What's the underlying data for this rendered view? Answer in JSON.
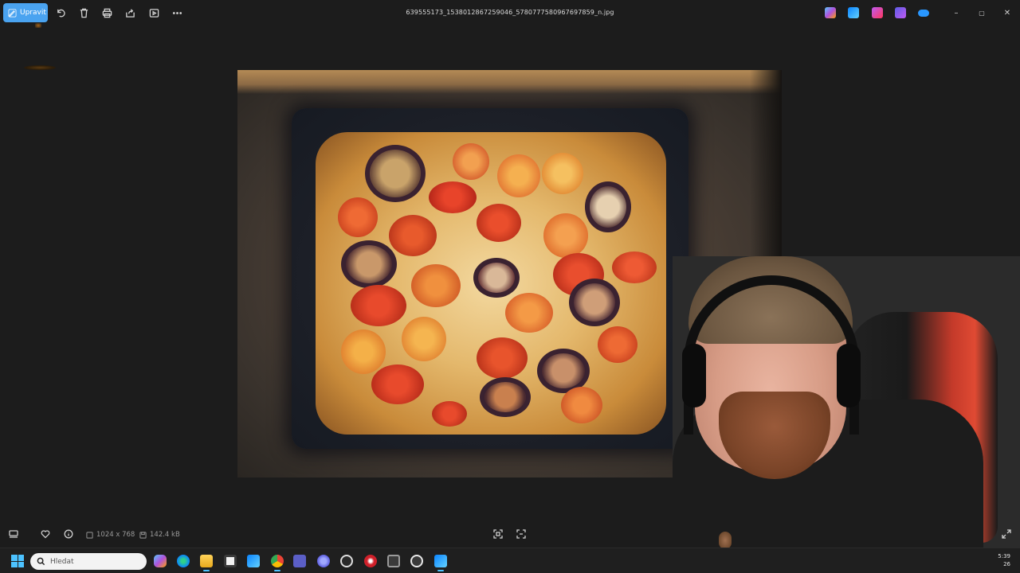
{
  "titlebar": {
    "edit_label": "Upravit",
    "filename": "639555173_1538012867259046_5780777580967697859_n.jpg",
    "icons": [
      "rotate-icon",
      "delete-icon",
      "print-icon",
      "share-icon",
      "slideshow-icon",
      "more-icon"
    ],
    "window_controls": [
      "–",
      "▢",
      "✕"
    ]
  },
  "infobar": {
    "dimensions": "1024 x 768",
    "size": "142.4 kB"
  },
  "taskbar": {
    "search_placeholder": "Hledat",
    "clock_time": "5:39",
    "clock_date": "26"
  },
  "colors": {
    "accent": "#4aa3f0",
    "background": "#1c1c1c"
  }
}
